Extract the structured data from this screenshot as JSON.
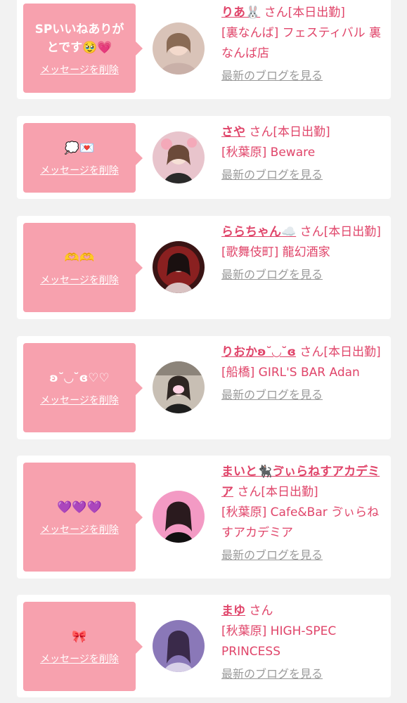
{
  "delete_label": "メッセージを削除",
  "honorific": " さん",
  "status_today": "[本日出勤]",
  "blog_label": "最新のブログを見る",
  "colors": {
    "accent": "#e0456a",
    "bubble": "#f7a1ae",
    "muted": "#9a9a9a",
    "background": "#f2f2f2"
  },
  "items": [
    {
      "message": "SPいいねありがとです🥹💗",
      "name": "りあ🐰",
      "status": "[本日出勤]",
      "shop": "[裏なんば] フェスティバル 裏なんば店",
      "avatar": "avatar-photo"
    },
    {
      "message": "💭💌",
      "name": "さや",
      "status": "[本日出勤]",
      "shop": "[秋葉原] Beware",
      "avatar": "avatar-photo"
    },
    {
      "message": "🫶🫶",
      "name": "ららちゃん☁️",
      "status": "[本日出勤]",
      "shop": "[歌舞伎町] 龍幻酒家",
      "avatar": "avatar-photo"
    },
    {
      "message": "ʚ˘◡˘ɞ♡♡",
      "name": "りおかʚ˘◡˘ɞ",
      "status": "[本日出勤]",
      "shop": "[船橋] GIRL'S BAR Adan",
      "avatar": "avatar-photo"
    },
    {
      "message": "💜💜💜",
      "name": "まいと🐈‍⬛ゔぃらねすアカデミア",
      "status": "[本日出勤]",
      "shop": "[秋葉原] Cafe&Bar ゔぃらねすアカデミア",
      "avatar": "avatar-photo"
    },
    {
      "message": "🎀",
      "name": "まゆ",
      "status": "",
      "shop": "[秋葉原] HIGH-SPEC PRINCESS",
      "avatar": "avatar-photo"
    }
  ]
}
